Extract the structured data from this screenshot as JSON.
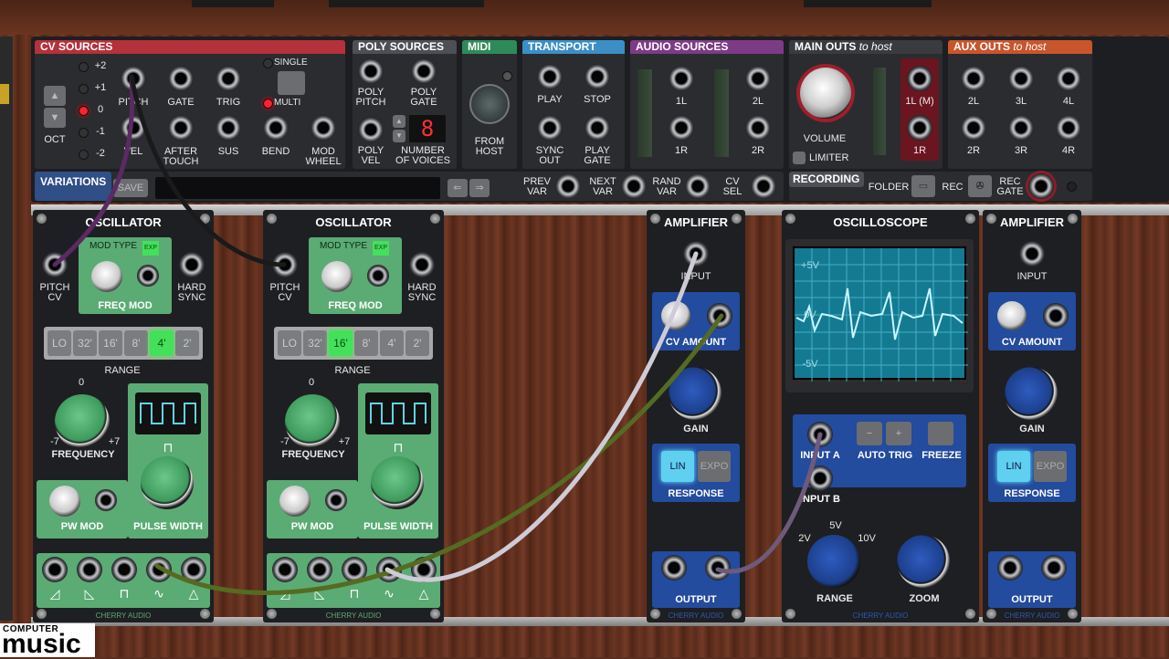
{
  "top_panel": {
    "cv_sources": {
      "title": "CV SOURCES",
      "octave_values": [
        "+2",
        "+1",
        "0",
        "-1",
        "-2"
      ],
      "oct_label": "OCT",
      "jacks_row1": [
        "PITCH",
        "GATE",
        "TRIG"
      ],
      "jacks_row2": [
        "VEL",
        "AFTER\nTOUCH",
        "SUS",
        "BEND",
        "MOD\nWHEEL"
      ],
      "single_label": "SINGLE",
      "multi_label": "MULTI"
    },
    "poly_sources": {
      "title": "POLY SOURCES",
      "labels": [
        "POLY\nPITCH",
        "POLY\nGATE",
        "POLY\nVEL"
      ],
      "voices_display": "8",
      "voices_label": "NUMBER\nOF VOICES"
    },
    "midi": {
      "title": "MIDI",
      "from_host": "FROM\nHOST"
    },
    "transport": {
      "title": "TRANSPORT",
      "labels": [
        "PLAY",
        "STOP",
        "SYNC\nOUT",
        "PLAY\nGATE"
      ]
    },
    "audio_sources": {
      "title": "AUDIO SOURCES",
      "labels": [
        "1L",
        "2L",
        "1R",
        "2R"
      ]
    },
    "main_outs": {
      "title": "MAIN OUTS",
      "subtitle": "to host",
      "volume": "VOLUME",
      "limiter": "LIMITER",
      "labels": [
        "1L (M)",
        "1R"
      ]
    },
    "aux_outs": {
      "title": "AUX OUTS",
      "subtitle": "to host",
      "labels": [
        "2L",
        "3L",
        "4L",
        "2R",
        "3R",
        "4R"
      ]
    },
    "variations": {
      "title": "VARIATIONS",
      "save": "SAVE",
      "prev": "PREV\nVAR",
      "next": "NEXT\nVAR",
      "rand": "RAND\nVAR",
      "cv_sel": "CV\nSEL"
    },
    "recording": {
      "title": "RECORDING",
      "folder": "FOLDER",
      "rec": "REC",
      "rec_gate": "REC\nGATE"
    }
  },
  "modules": {
    "osc1": {
      "title": "OSCILLATOR",
      "mod_type": "MOD TYPE",
      "exp": "EXP",
      "pitch_cv": "PITCH\nCV",
      "freq_mod": "FREQ MOD",
      "hard_sync": "HARD\nSYNC",
      "ranges": [
        "LO",
        "32'",
        "16'",
        "8'",
        "4'",
        "2'"
      ],
      "active_range": "4'",
      "range_label": "RANGE",
      "freq_zero": "0",
      "freq_min": "-7",
      "freq_max": "+7",
      "frequency": "FREQUENCY",
      "pw_mod": "PW MOD",
      "pulse_width": "PULSE WIDTH",
      "brand": "CHERRY AUDIO"
    },
    "osc2": {
      "title": "OSCILLATOR",
      "mod_type": "MOD TYPE",
      "exp": "EXP",
      "pitch_cv": "PITCH\nCV",
      "freq_mod": "FREQ MOD",
      "hard_sync": "HARD\nSYNC",
      "ranges": [
        "LO",
        "32'",
        "16'",
        "8'",
        "4'",
        "2'"
      ],
      "active_range": "16'",
      "range_label": "RANGE",
      "freq_zero": "0",
      "freq_min": "-7",
      "freq_max": "+7",
      "frequency": "FREQUENCY",
      "pw_mod": "PW MOD",
      "pulse_width": "PULSE WIDTH",
      "brand": "CHERRY AUDIO"
    },
    "amp1": {
      "title": "AMPLIFIER",
      "input": "INPUT",
      "cv_amount": "CV AMOUNT",
      "gain": "GAIN",
      "lin": "LIN",
      "expo": "EXPO",
      "response": "RESPONSE",
      "output": "OUTPUT",
      "brand": "CHERRY AUDIO"
    },
    "scope": {
      "title": "OSCILLOSCOPE",
      "top_v": "+5V",
      "mid_v": "0V",
      "bot_v": "-5V",
      "input_a": "INPUT A",
      "input_b": "INPUT B",
      "auto_trig": "AUTO TRIG",
      "freeze": "FREEZE",
      "range_2v": "2V",
      "range_5v": "5V",
      "range_10v": "10V",
      "range": "RANGE",
      "zoom": "ZOOM",
      "brand": "CHERRY AUDIO"
    },
    "amp2": {
      "title": "AMPLIFIER",
      "input": "INPUT",
      "cv_amount": "CV AMOUNT",
      "gain": "GAIN",
      "lin": "LIN",
      "expo": "EXPO",
      "response": "RESPONSE",
      "output": "OUTPUT",
      "brand": "CHERRY AUDIO"
    }
  },
  "watermark": {
    "line1": "COMPUTER",
    "line2": "music"
  },
  "colors": {
    "cv": "#b5313b",
    "poly": "#4d4f55",
    "midi": "#2f8a59",
    "transport": "#3b8fc6",
    "audio": "#7d3b86",
    "main": "#3a3b3f",
    "aux": "#c9552d",
    "module_green": "#5bab74",
    "module_blue": "#234b9e"
  }
}
